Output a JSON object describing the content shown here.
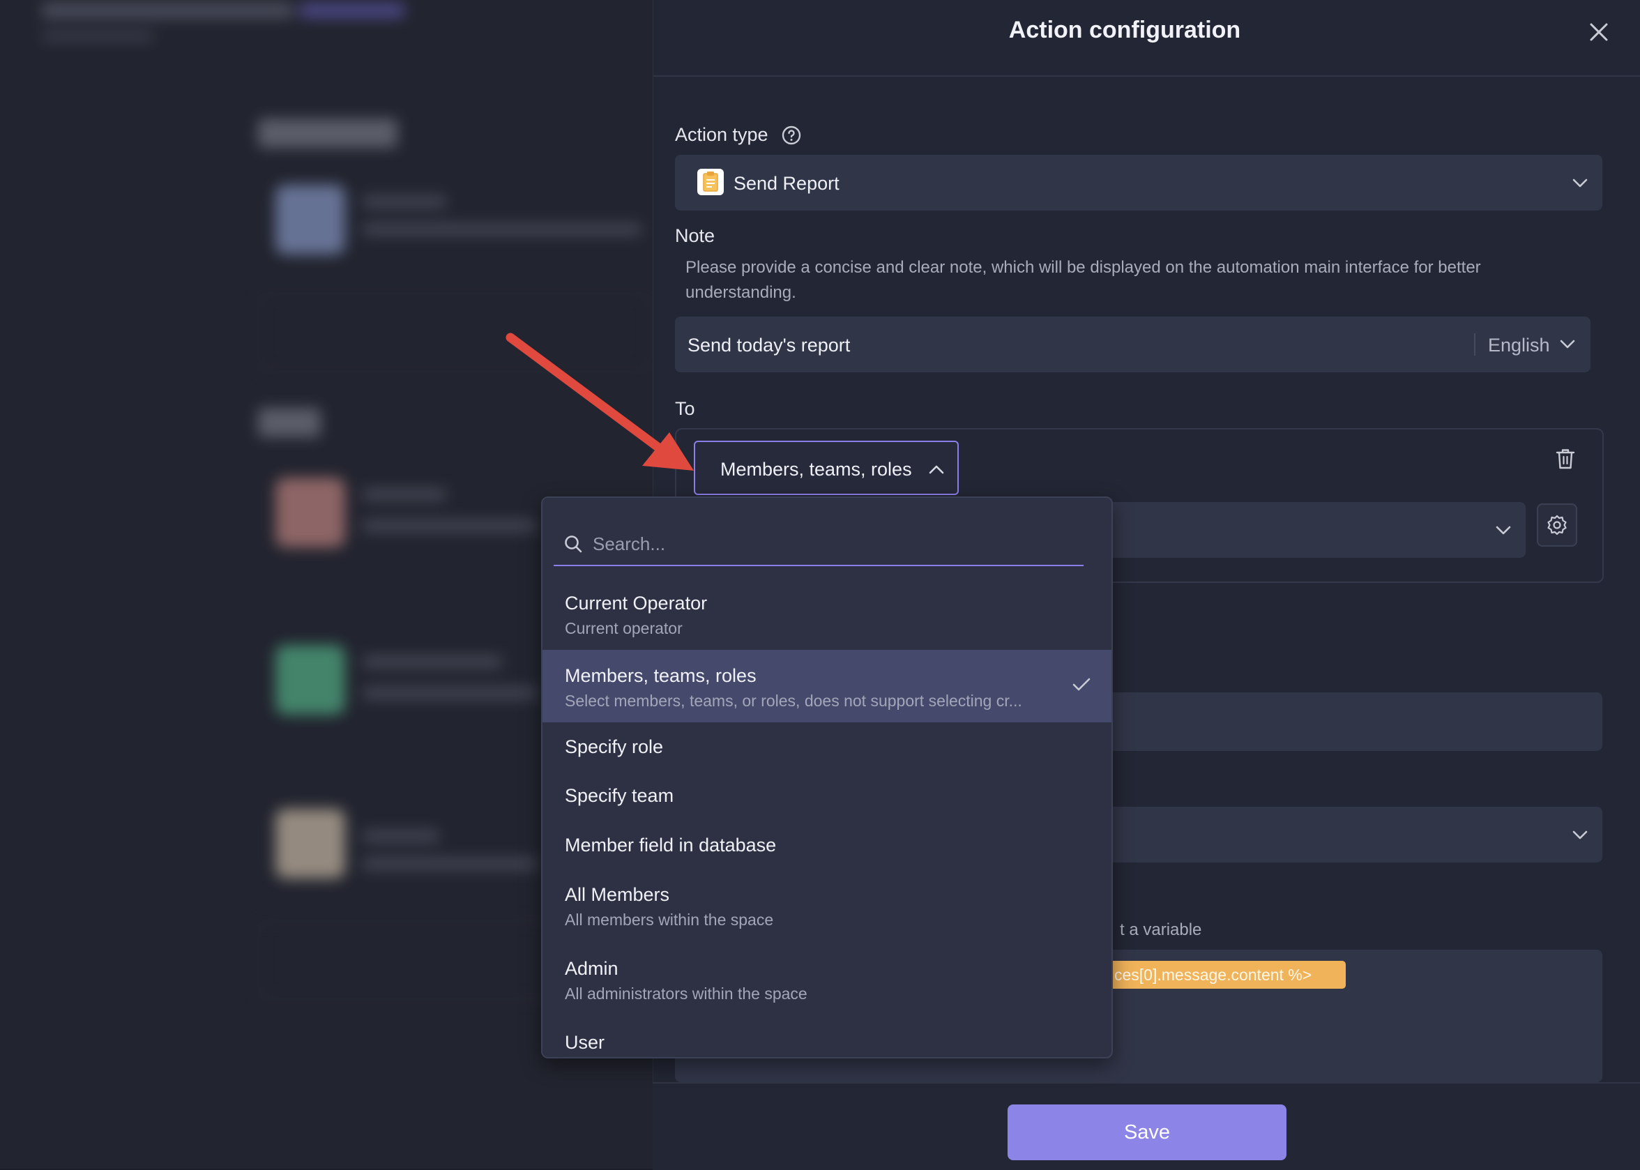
{
  "panel": {
    "title": "Action configuration",
    "action_type_label": "Action type",
    "action_type_value": "Send Report",
    "note_label": "Note",
    "note_description": "Please provide a concise and clear note, which will be displayed on the automation main interface for better understanding.",
    "note_value": "Send today's report",
    "note_language": "English",
    "to_label": "To",
    "to_trigger_value": "Members, teams, roles",
    "variable_hint": "t a variable",
    "variable_chip": "ces[0].message.content %>",
    "save_label": "Save"
  },
  "dropdown": {
    "search_placeholder": "Search...",
    "options": [
      {
        "title": "Current Operator",
        "subtitle": "Current operator"
      },
      {
        "title": "Members, teams, roles",
        "subtitle": "Select members, teams, or roles, does not support selecting cr...",
        "selected": true
      },
      {
        "title": "Specify role"
      },
      {
        "title": "Specify team"
      },
      {
        "title": "Member field in database"
      },
      {
        "title": "All Members",
        "subtitle": "All members within the space"
      },
      {
        "title": "Admin",
        "subtitle": "All administrators within the space"
      },
      {
        "title": "User"
      }
    ]
  },
  "icons": {
    "close": "close-icon",
    "help": "help-icon",
    "report": "report-icon",
    "chevron": "chevron-down-icon",
    "trash": "trash-icon",
    "gear": "gear-icon",
    "search": "search-icon",
    "check": "check-icon",
    "arrow": "annotation-arrow"
  },
  "colors": {
    "accent": "#8c84e6",
    "annotation_arrow": "#e0493d",
    "variable_chip": "#f0b35a"
  }
}
